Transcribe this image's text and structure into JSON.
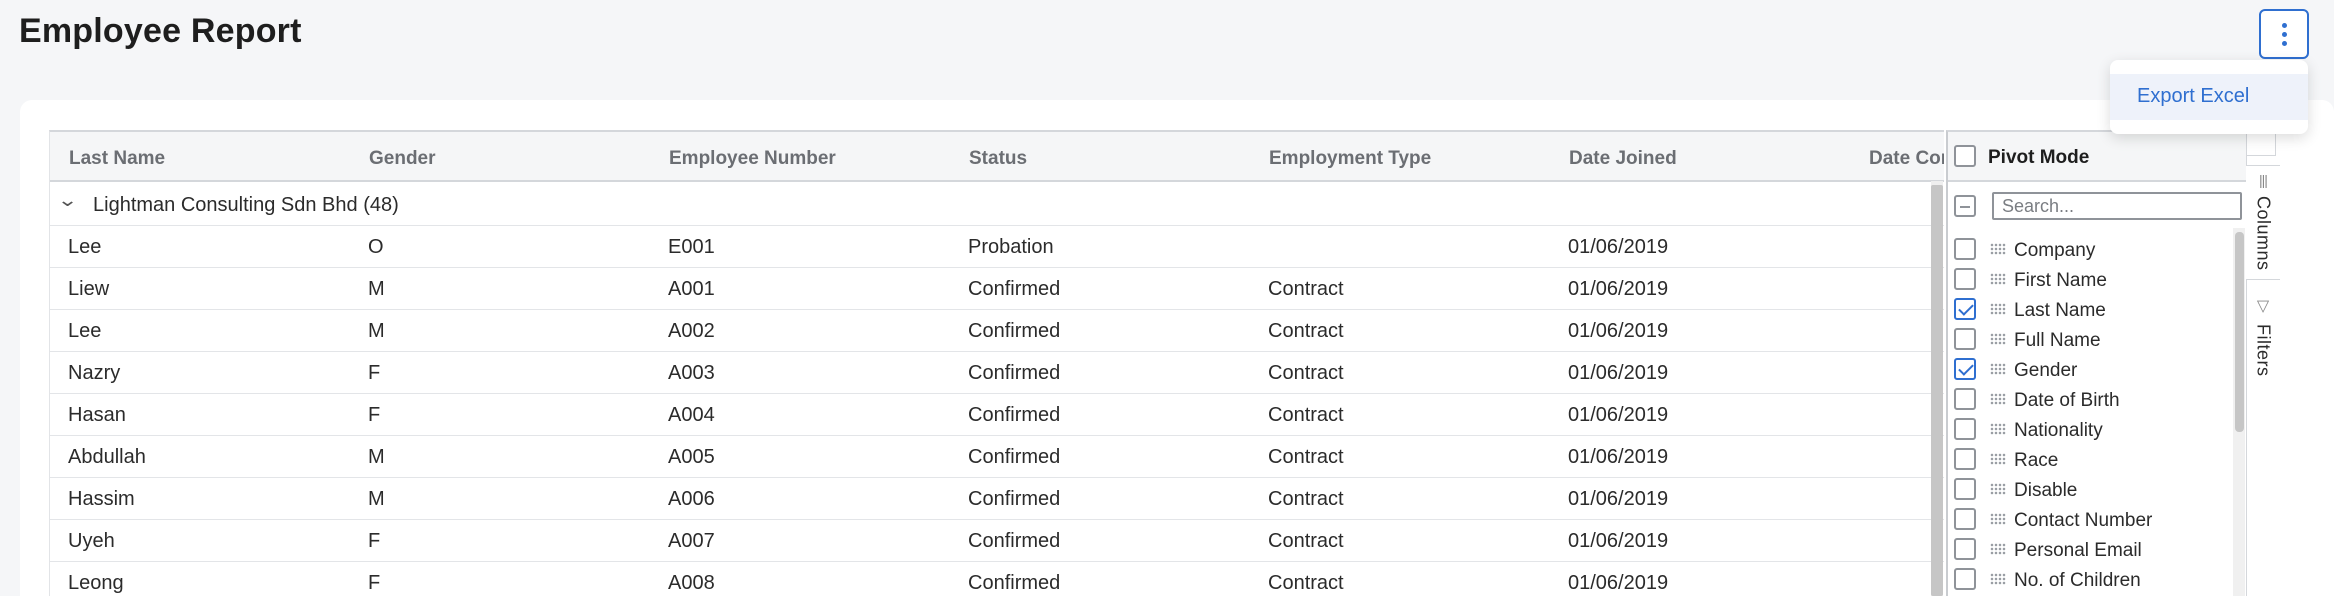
{
  "page": {
    "title": "Employee Report"
  },
  "menu": {
    "export_label": "Export Excel"
  },
  "grid": {
    "columns": [
      "Last Name",
      "Gender",
      "Employee Number",
      "Status",
      "Employment Type",
      "Date Joined",
      "Date Cor"
    ],
    "group": {
      "label": "Lightman Consulting Sdn Bhd",
      "count": "(48)"
    },
    "rows": [
      [
        "Lee",
        "O",
        "E001",
        "Probation",
        "",
        "01/06/2019"
      ],
      [
        "Liew",
        "M",
        "A001",
        "Confirmed",
        "Contract",
        "01/06/2019"
      ],
      [
        "Lee",
        "M",
        "A002",
        "Confirmed",
        "Contract",
        "01/06/2019"
      ],
      [
        "Nazry",
        "F",
        "A003",
        "Confirmed",
        "Contract",
        "01/06/2019"
      ],
      [
        "Hasan",
        "F",
        "A004",
        "Confirmed",
        "Contract",
        "01/06/2019"
      ],
      [
        "Abdullah",
        "M",
        "A005",
        "Confirmed",
        "Contract",
        "01/06/2019"
      ],
      [
        "Hassim",
        "M",
        "A006",
        "Confirmed",
        "Contract",
        "01/06/2019"
      ],
      [
        "Uyeh",
        "F",
        "A007",
        "Confirmed",
        "Contract",
        "01/06/2019"
      ],
      [
        "Leong",
        "F",
        "A008",
        "Confirmed",
        "Contract",
        "01/06/2019"
      ]
    ]
  },
  "tool_panel": {
    "pivot_mode_label": "Pivot Mode",
    "search_placeholder": "Search...",
    "columns": [
      {
        "label": "Company",
        "checked": false
      },
      {
        "label": "First Name",
        "checked": false
      },
      {
        "label": "Last Name",
        "checked": true
      },
      {
        "label": "Full Name",
        "checked": false
      },
      {
        "label": "Gender",
        "checked": true
      },
      {
        "label": "Date of Birth",
        "checked": false
      },
      {
        "label": "Nationality",
        "checked": false
      },
      {
        "label": "Race",
        "checked": false
      },
      {
        "label": "Disable",
        "checked": false
      },
      {
        "label": "Contact Number",
        "checked": false
      },
      {
        "label": "Personal Email",
        "checked": false
      },
      {
        "label": "No. of Children",
        "checked": false
      }
    ],
    "tabs": {
      "columns": "Columns",
      "filters": "Filters"
    }
  },
  "colors": {
    "accent": "#2f6fd0",
    "header_bg": "#f5f6f7",
    "page_bg": "#f5f6f8"
  }
}
